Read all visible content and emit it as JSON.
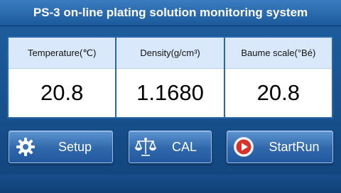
{
  "title": "PS-3 on-line plating solution monitoring system",
  "readings": [
    {
      "label": "Temperature(℃)",
      "value": "20.8"
    },
    {
      "label": "Density(g/cm³)",
      "value": "1.1680"
    },
    {
      "label": "Baume scale(°Bé)",
      "value": "20.8"
    }
  ],
  "buttons": {
    "setup_label": "Setup",
    "cal_label": "CAL",
    "run_label": "StartRun"
  },
  "icons": {
    "setup": "gear-icon",
    "cal": "balance-scale-icon",
    "run": "play-icon"
  },
  "colors": {
    "background": "#1b5896",
    "header_cell": "#d9e9fb",
    "play_red": "#d9322b"
  }
}
